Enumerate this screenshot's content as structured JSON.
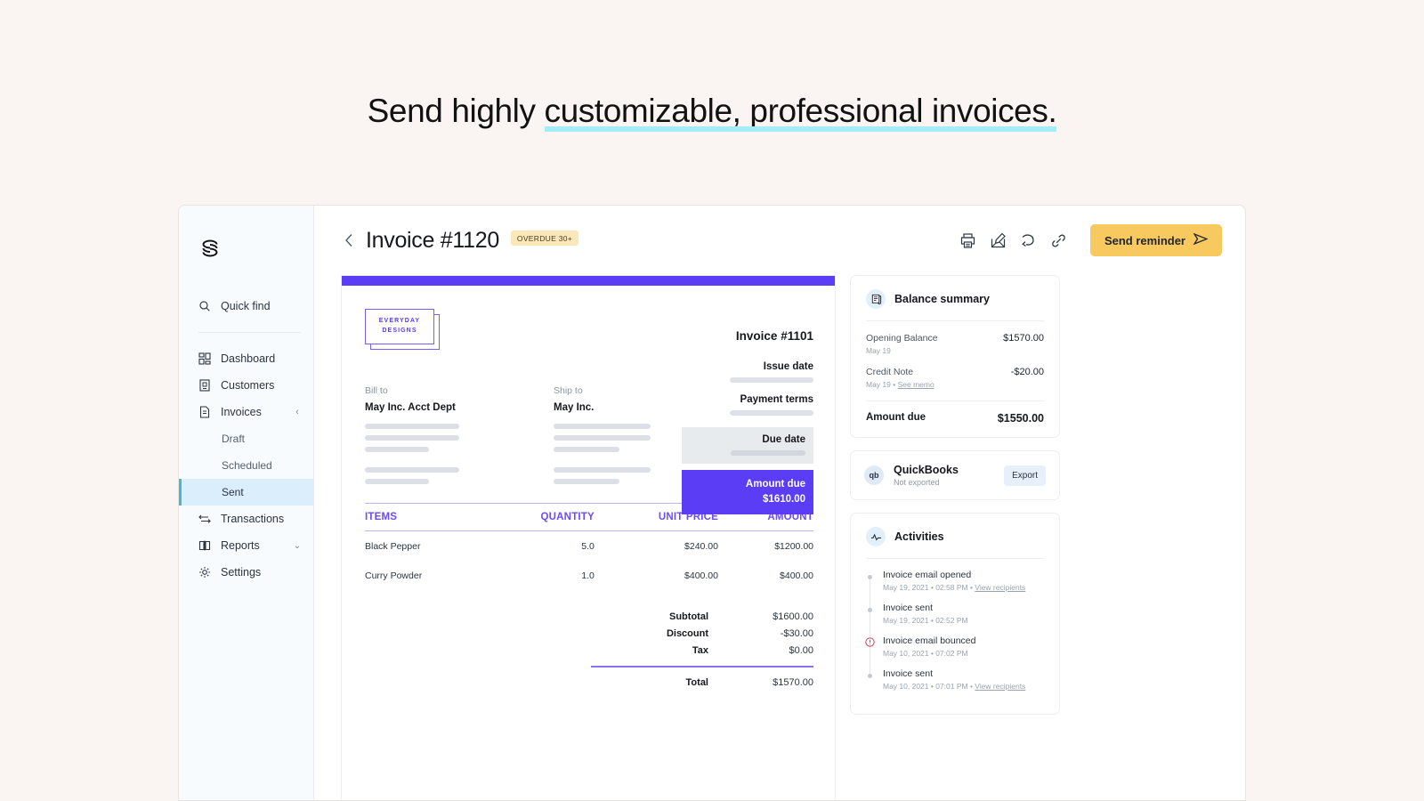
{
  "headline": {
    "plain": "Send highly ",
    "highlighted": "customizable, professional invoices."
  },
  "colors": {
    "page_background": "#faf5f2",
    "highlight": "#a5ecf8",
    "accent_purple": "#5b3df5",
    "accent_yellow": "#f7c95f",
    "badge_yellow": "#fae8bb",
    "sidebar_active_bg": "#daeefb",
    "sidebar_active_border": "#49b6d6",
    "error_red": "#e0384a"
  },
  "sidebar": {
    "logo_name": "spiral-s-logo",
    "quick_find": {
      "label": "Quick find",
      "icon": "search-icon"
    },
    "items": [
      {
        "label": "Dashboard",
        "icon": "dashboard-icon",
        "chevron": ""
      },
      {
        "label": "Customers",
        "icon": "customers-icon",
        "chevron": ""
      },
      {
        "label": "Invoices",
        "icon": "invoices-icon",
        "chevron": "‹"
      }
    ],
    "sub_items": [
      {
        "label": "Draft",
        "active": false
      },
      {
        "label": "Scheduled",
        "active": false
      },
      {
        "label": "Sent",
        "active": true
      }
    ],
    "items_after": [
      {
        "label": "Transactions",
        "icon": "transactions-icon",
        "chevron": ""
      },
      {
        "label": "Reports",
        "icon": "reports-icon",
        "chevron": "⌄"
      },
      {
        "label": "Settings",
        "icon": "gear-icon",
        "chevron": ""
      }
    ]
  },
  "topbar": {
    "back_icon": "chevron-left-icon",
    "title": "Invoice #1120",
    "badge": "OVERDUE 30+",
    "icons": [
      "print-icon",
      "edit-icon",
      "refund-icon",
      "link-icon"
    ],
    "send_button": "Send reminder",
    "send_button_icon": "send-plane-icon"
  },
  "invoice": {
    "brand_line1": "EVERYDAY",
    "brand_line2": "DESIGNS",
    "number": "Invoice #1101",
    "meta": [
      {
        "label": "Issue date",
        "value": "",
        "style": "plain"
      },
      {
        "label": "Payment terms",
        "value": "",
        "style": "plain"
      },
      {
        "label": "Due date",
        "value": "",
        "style": "gray"
      }
    ],
    "amount_due_label": "Amount due",
    "amount_due_value": "$1610.00",
    "bill_to_label": "Bill to",
    "bill_to_name": "May Inc. Acct Dept",
    "ship_to_label": "Ship to",
    "ship_to_name": "May Inc.",
    "table": {
      "headers": [
        "ITEMS",
        "QUANTITY",
        "UNIT PRICE",
        "AMOUNT"
      ],
      "rows": [
        [
          "Black Pepper",
          "5.0",
          "$240.00",
          "$1200.00"
        ],
        [
          "Curry Powder",
          "1.0",
          "$400.00",
          "$400.00"
        ]
      ]
    },
    "totals": [
      {
        "label": "Subtotal",
        "value": "$1600.00"
      },
      {
        "label": "Discount",
        "value": "-$30.00"
      },
      {
        "label": "Tax",
        "value": "$0.00"
      }
    ],
    "total_label": "Total",
    "total_value": "$1570.00"
  },
  "balance_summary": {
    "icon": "receipt-icon",
    "title": "Balance summary",
    "rows": [
      {
        "name": "Opening Balance",
        "sub": "May 19",
        "sub_link": "",
        "value": "$1570.00"
      },
      {
        "name": "Credit Note",
        "sub": "May 19  •  ",
        "sub_link": "See memo",
        "value": "-$20.00"
      }
    ],
    "total_label": "Amount due",
    "total_value": "$1550.00"
  },
  "quickbooks": {
    "icon_text": "qb",
    "name": "QuickBooks",
    "status": "Not exported",
    "button": "Export"
  },
  "activities": {
    "icon": "pulse-icon",
    "title": "Activities",
    "items": [
      {
        "name": "Invoice email opened",
        "meta": "May 19, 2021  •  02:58 PM  •  ",
        "link": "View recipients",
        "state": "normal"
      },
      {
        "name": "Invoice sent",
        "meta": "May 19, 2021  •  02:52 PM",
        "link": "",
        "state": "normal"
      },
      {
        "name": "Invoice email bounced",
        "meta": "May 10, 2021  •  07:02 PM",
        "link": "",
        "state": "error"
      },
      {
        "name": "Invoice sent",
        "meta": "May 10, 2021  •  07:01 PM  •  ",
        "link": "View recipients",
        "state": "normal"
      }
    ]
  }
}
